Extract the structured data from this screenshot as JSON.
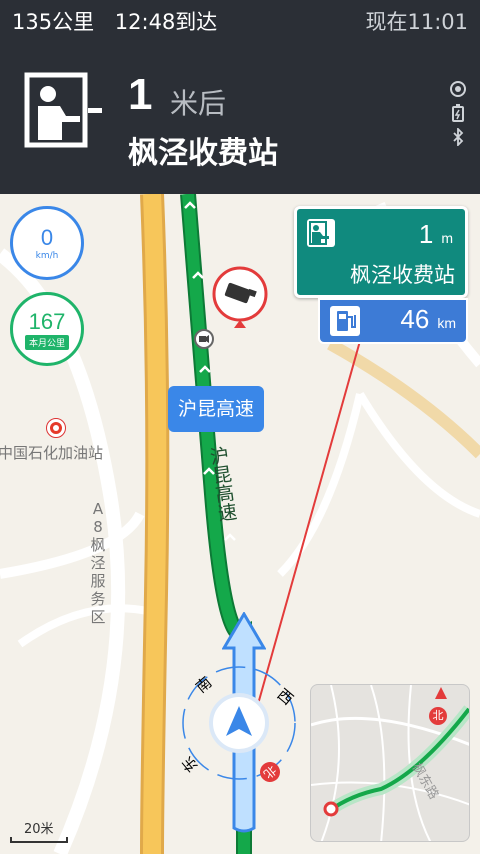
{
  "status_bar": {
    "remaining": "135公里",
    "arrival": "12:48到达",
    "now": "现在11:01"
  },
  "guidance": {
    "distance": "1",
    "unit": "米后",
    "road_name": "枫泾收费站",
    "icon": "toll-booth-icon",
    "status_icons": [
      "gps-icon",
      "battery-icon",
      "bluetooth-icon"
    ]
  },
  "speed": {
    "value": "0",
    "unit": "km/h"
  },
  "monthly_distance": {
    "value": "167",
    "label": "本月公里"
  },
  "toll_sign": {
    "distance": "1",
    "unit": "m",
    "name": "枫泾收费站",
    "color": "#108a7e"
  },
  "fuel_sign": {
    "distance": "46",
    "unit": "km",
    "color": "#3d7bd6"
  },
  "map_labels": {
    "highway_tip": "沪昆高速",
    "road_vertical": "沪昆高速",
    "gas_station": "中国石化加油站",
    "service_area": "A8枫泾服务区",
    "service_area_lines": [
      "A",
      "8",
      "枫",
      "泾",
      "服",
      "务",
      "区"
    ]
  },
  "compass": {
    "n": "北",
    "s": "南",
    "e": "东",
    "w": "西"
  },
  "minimap": {
    "north": "北",
    "road": "枫东路"
  },
  "scale": "20米",
  "colors": {
    "route": "#14a84a",
    "topbar": "#2b2f36",
    "highway": "#f7c65a",
    "car": "#3a87e8"
  }
}
